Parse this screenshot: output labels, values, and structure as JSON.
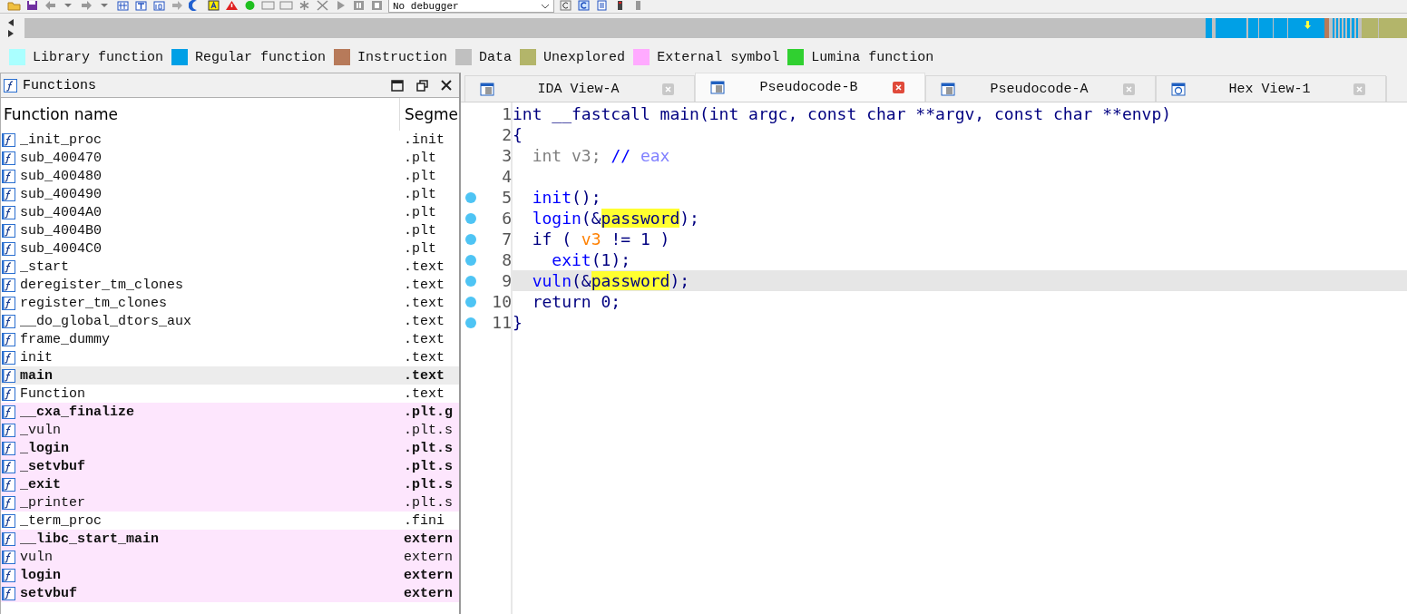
{
  "toolbar": {
    "debugger": "No debugger"
  },
  "legend": [
    {
      "label": "Library function",
      "color": "#aaffff"
    },
    {
      "label": "Regular function",
      "color": "#00a0e6"
    },
    {
      "label": "Instruction",
      "color": "#b77a5a"
    },
    {
      "label": "Data",
      "color": "#c0c0c0"
    },
    {
      "label": "Unexplored",
      "color": "#b3b56a"
    },
    {
      "label": "External symbol",
      "color": "#ffaaff"
    },
    {
      "label": "Lumina function",
      "color": "#30d030"
    }
  ],
  "functions": {
    "title": "Functions",
    "columns": [
      "Function name",
      "Segme"
    ],
    "rows": [
      {
        "name": "_init_proc",
        "segment": ".init",
        "bold": false,
        "external": false,
        "selected": false
      },
      {
        "name": "sub_400470",
        "segment": ".plt",
        "bold": false,
        "external": false,
        "selected": false
      },
      {
        "name": "sub_400480",
        "segment": ".plt",
        "bold": false,
        "external": false,
        "selected": false
      },
      {
        "name": "sub_400490",
        "segment": ".plt",
        "bold": false,
        "external": false,
        "selected": false
      },
      {
        "name": "sub_4004A0",
        "segment": ".plt",
        "bold": false,
        "external": false,
        "selected": false
      },
      {
        "name": "sub_4004B0",
        "segment": ".plt",
        "bold": false,
        "external": false,
        "selected": false
      },
      {
        "name": "sub_4004C0",
        "segment": ".plt",
        "bold": false,
        "external": false,
        "selected": false
      },
      {
        "name": "_start",
        "segment": ".text",
        "bold": false,
        "external": false,
        "selected": false
      },
      {
        "name": "deregister_tm_clones",
        "segment": ".text",
        "bold": false,
        "external": false,
        "selected": false
      },
      {
        "name": "register_tm_clones",
        "segment": ".text",
        "bold": false,
        "external": false,
        "selected": false
      },
      {
        "name": "__do_global_dtors_aux",
        "segment": ".text",
        "bold": false,
        "external": false,
        "selected": false
      },
      {
        "name": "frame_dummy",
        "segment": ".text",
        "bold": false,
        "external": false,
        "selected": false
      },
      {
        "name": "init",
        "segment": ".text",
        "bold": false,
        "external": false,
        "selected": false
      },
      {
        "name": "main",
        "segment": ".text",
        "bold": true,
        "external": false,
        "selected": true
      },
      {
        "name": "Function",
        "segment": ".text",
        "bold": false,
        "external": false,
        "selected": false
      },
      {
        "name": "__cxa_finalize",
        "segment": ".plt.g",
        "bold": true,
        "external": true,
        "selected": false
      },
      {
        "name": "_vuln",
        "segment": ".plt.s",
        "bold": false,
        "external": true,
        "selected": false
      },
      {
        "name": "_login",
        "segment": ".plt.s",
        "bold": true,
        "external": true,
        "selected": false
      },
      {
        "name": "_setvbuf",
        "segment": ".plt.s",
        "bold": true,
        "external": true,
        "selected": false
      },
      {
        "name": "_exit",
        "segment": ".plt.s",
        "bold": true,
        "external": true,
        "selected": false
      },
      {
        "name": "_printer",
        "segment": ".plt.s",
        "bold": false,
        "external": true,
        "selected": false
      },
      {
        "name": "_term_proc",
        "segment": ".fini",
        "bold": false,
        "external": false,
        "selected": false
      },
      {
        "name": "__libc_start_main",
        "segment": "extern",
        "bold": true,
        "external": true,
        "selected": false
      },
      {
        "name": "vuln",
        "segment": "extern",
        "bold": false,
        "external": true,
        "selected": false
      },
      {
        "name": "login",
        "segment": "extern",
        "bold": true,
        "external": true,
        "selected": false
      },
      {
        "name": "setvbuf",
        "segment": "extern",
        "bold": true,
        "external": true,
        "selected": false
      }
    ]
  },
  "tabs": [
    {
      "label": "IDA View-A",
      "kind": "doc",
      "selected": false
    },
    {
      "label": "Pseudocode-B",
      "kind": "doc",
      "selected": true
    },
    {
      "label": "Pseudocode-A",
      "kind": "doc",
      "selected": false
    },
    {
      "label": "Hex View-1",
      "kind": "hex",
      "selected": false
    }
  ],
  "code": [
    {
      "number": "1",
      "dot": false,
      "current": false,
      "tokens": [
        {
          "kind": "text",
          "text": "int __fastcall main(int argc, const char **argv, const char **envp)"
        }
      ]
    },
    {
      "number": "2",
      "dot": false,
      "current": false,
      "tokens": [
        {
          "kind": "text",
          "text": "{"
        }
      ]
    },
    {
      "number": "3",
      "dot": false,
      "current": false,
      "tokens": [
        {
          "kind": "dim",
          "text": "  int v3;"
        },
        {
          "kind": "comment",
          "text": " //"
        },
        {
          "kind": "note",
          "text": " eax"
        }
      ]
    },
    {
      "number": "4",
      "dot": false,
      "current": false
    },
    {
      "number": "5",
      "dot": true,
      "current": false,
      "tokens": [
        {
          "kind": "func",
          "text": "  init"
        },
        {
          "kind": "text",
          "text": "();"
        }
      ]
    },
    {
      "number": "6",
      "dot": true,
      "current": false,
      "tokens": [
        {
          "kind": "func",
          "text": "  login"
        },
        {
          "kind": "text",
          "text": "(&"
        },
        {
          "kind": "match",
          "text": "password"
        },
        {
          "kind": "text",
          "text": ");"
        }
      ]
    },
    {
      "number": "7",
      "dot": true,
      "current": false,
      "tokens": [
        {
          "kind": "text",
          "text": "  if ( "
        },
        {
          "kind": "var",
          "text": "v3"
        },
        {
          "kind": "text",
          "text": " != 1 )"
        }
      ]
    },
    {
      "number": "8",
      "dot": true,
      "current": false,
      "tokens": [
        {
          "kind": "func",
          "text": "    exit"
        },
        {
          "kind": "text",
          "text": "(1);"
        }
      ]
    },
    {
      "number": "9",
      "dot": true,
      "current": true,
      "tokens": [
        {
          "kind": "func",
          "text": "  vuln"
        },
        {
          "kind": "text",
          "text": "(&"
        },
        {
          "kind": "match",
          "text": "password"
        },
        {
          "kind": "text",
          "text": ");"
        }
      ]
    },
    {
      "number": "10",
      "dot": true,
      "current": false,
      "tokens": [
        {
          "kind": "text",
          "text": "  return 0;"
        }
      ]
    },
    {
      "number": "11",
      "dot": true,
      "current": false,
      "tokens": [
        {
          "kind": "text",
          "text": "}"
        }
      ]
    }
  ]
}
